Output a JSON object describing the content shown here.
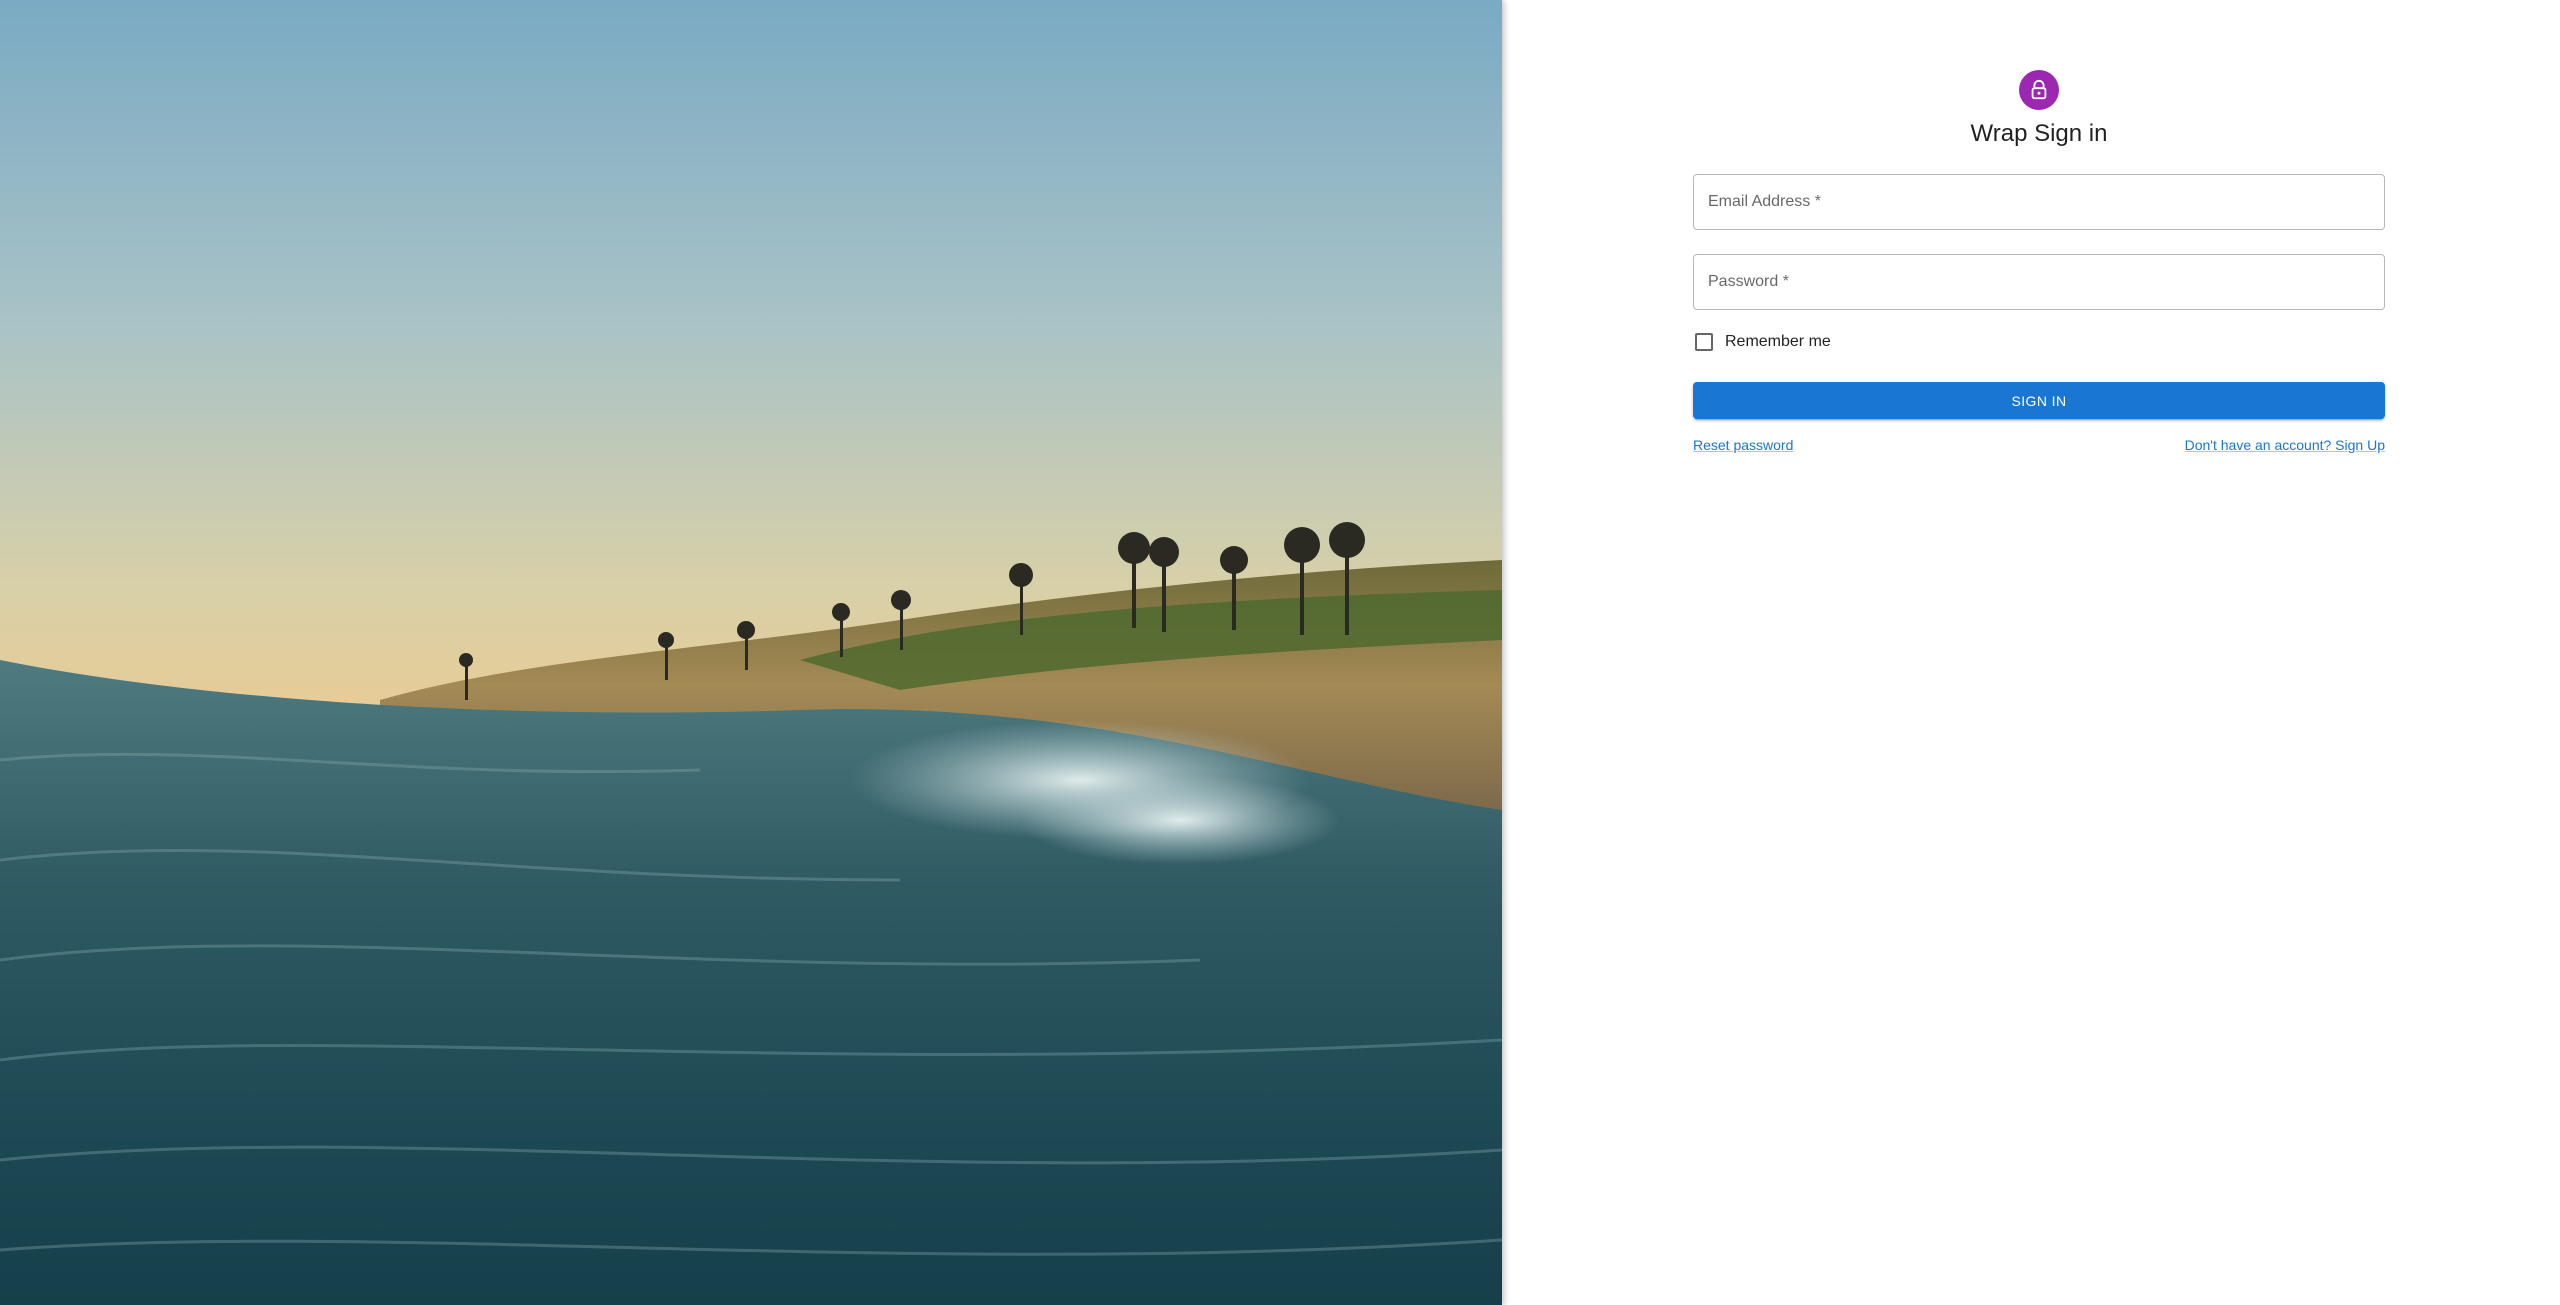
{
  "hero": {
    "image_description_icon": "ocean-wave-sunset-photo"
  },
  "signin": {
    "avatar_icon": "lock-icon",
    "title": "Wrap Sign in",
    "email": {
      "label": "Email Address *",
      "value": ""
    },
    "password": {
      "label": "Password *",
      "value": ""
    },
    "remember_label": "Remember me",
    "remember_checked": false,
    "submit_label": "Sign In",
    "reset_link": "Reset password",
    "signup_link": "Don't have an account? Sign Up"
  },
  "colors": {
    "avatar": "#9c27b0",
    "primary": "#1976d2"
  }
}
